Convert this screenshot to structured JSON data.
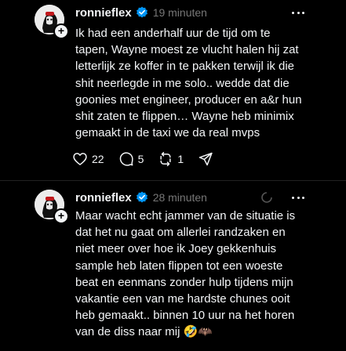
{
  "colors": {
    "background": "#000000",
    "text": "#f3f5f7",
    "muted": "#777777",
    "verified": "#0095f6",
    "divider": "#222222"
  },
  "posts": [
    {
      "username": "ronnieflex",
      "time": "19 minuten",
      "text": "Ik had een anderhalf uur de tijd om te\ntapen, Wayne moest ze vlucht halen hij zat\nletterlijk ze koffer in te pakken terwijl ik die\nshit neerlegde in me solo.. wedde dat die\ngoonies met engineer, producer en a&r hun\nshit zaten te flippen… Wayne heb minimix\ngemaakt in de taxi we da real mvps",
      "likes": "22",
      "replies": "5",
      "reposts": "1",
      "icons": [
        "heart-icon",
        "comment-icon",
        "repost-icon",
        "share-icon"
      ]
    },
    {
      "username": "ronnieflex",
      "time": "28 minuten",
      "text": "Maar wacht echt jammer van de situatie is\ndat het nu gaat om allerlei randzaken en\nniet meer over hoe ik Joey gekkenhuis\nsample heb laten flippen tot een woeste\nbeat en eenmans zonder hulp tijdens mijn\nvakantie een van me hardste chunes ooit\nheb gemaakt.. binnen 10 uur na het horen\nvan de diss naar mij 🤣🦇"
    }
  ]
}
